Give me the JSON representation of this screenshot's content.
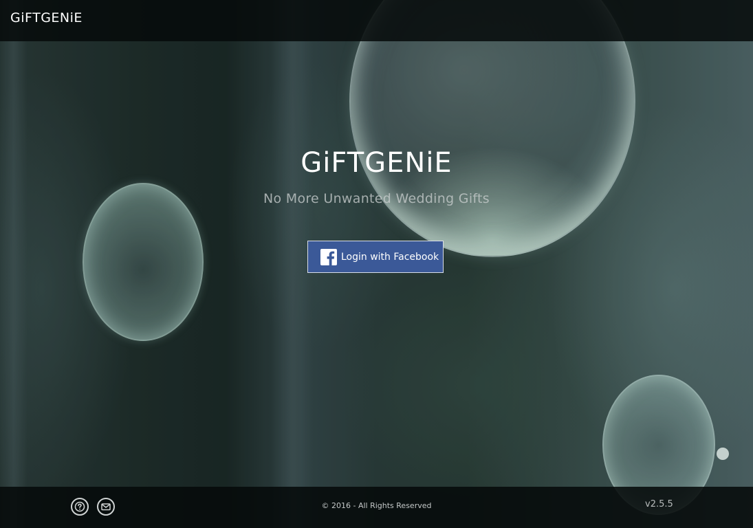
{
  "header": {
    "brand": "GiFTGENiE"
  },
  "hero": {
    "title": "GiFTGENiE",
    "subtitle": "No More Unwanted Wedding Gifts",
    "login_button_label": "Login with Facebook",
    "login_button_icon": "facebook-logo-icon",
    "login_button_color": "#3b5998"
  },
  "footer": {
    "help_icon": "question-circle-icon",
    "mail_icon": "envelope-icon",
    "copyright": "© 2016 - All Rights Reserved",
    "version": "v2.5.5"
  }
}
